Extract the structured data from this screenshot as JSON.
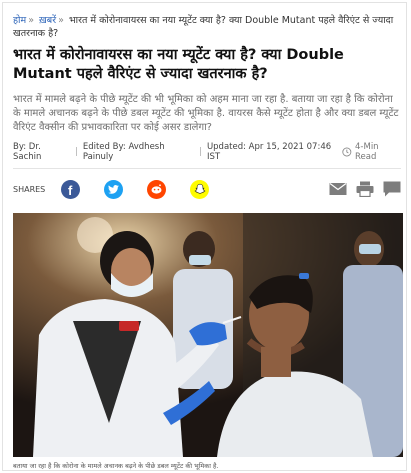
{
  "breadcrumb": {
    "home": "होम",
    "sep1": "»",
    "news": "ख़बरें",
    "sep2": "»",
    "current": "भारत में कोरोनावायरस का नया म्यूटेंट क्या है? क्या Double Mutant पहले वैरिएंट से ज्यादा खतरनाक है?"
  },
  "article": {
    "title": "भारत में कोरोनावायरस का नया म्यूटेंट क्या है? क्या Double Mutant पहले वैरिएंट से ज्यादा खतरनाक है?",
    "summary": "भारत में मामले बढ़ने के पीछे म्यूटेंट की भी भूमिका को अहम माना जा रहा है. बताया जा रहा है कि कोरोना के मामले अचानक बढ़ने के पीछे डबल म्यूटेंट की भूमिका है. वायरस कैसे म्यूटेंट होता है और क्या डबल म्यूटेंट वैरिएंट वैक्सीन की प्रभावकारिता पर कोई असर डालेगा?",
    "by": "By: Dr. Sachin",
    "edited": "Edited By: Avdhesh Painuly",
    "updated": "Updated: Apr 15, 2021 07:46 IST",
    "read_time": "4-Min Read",
    "caption": "बताया जा रहा है कि कोरोना के मामले अचानक बढ़ने के पीछे डबल म्यूटेंट की भूमिका है."
  },
  "share": {
    "label": "SHARES",
    "icons": [
      "facebook-icon",
      "twitter-icon",
      "reddit-icon",
      "snapchat-icon"
    ],
    "tools": [
      "email-icon",
      "print-icon",
      "comment-icon"
    ]
  },
  "colors": {
    "link": "#2b63b8",
    "facebook": "#3b5998",
    "twitter": "#1da1f2",
    "reddit": "#ff4500",
    "snapchat": "#fffc00"
  }
}
